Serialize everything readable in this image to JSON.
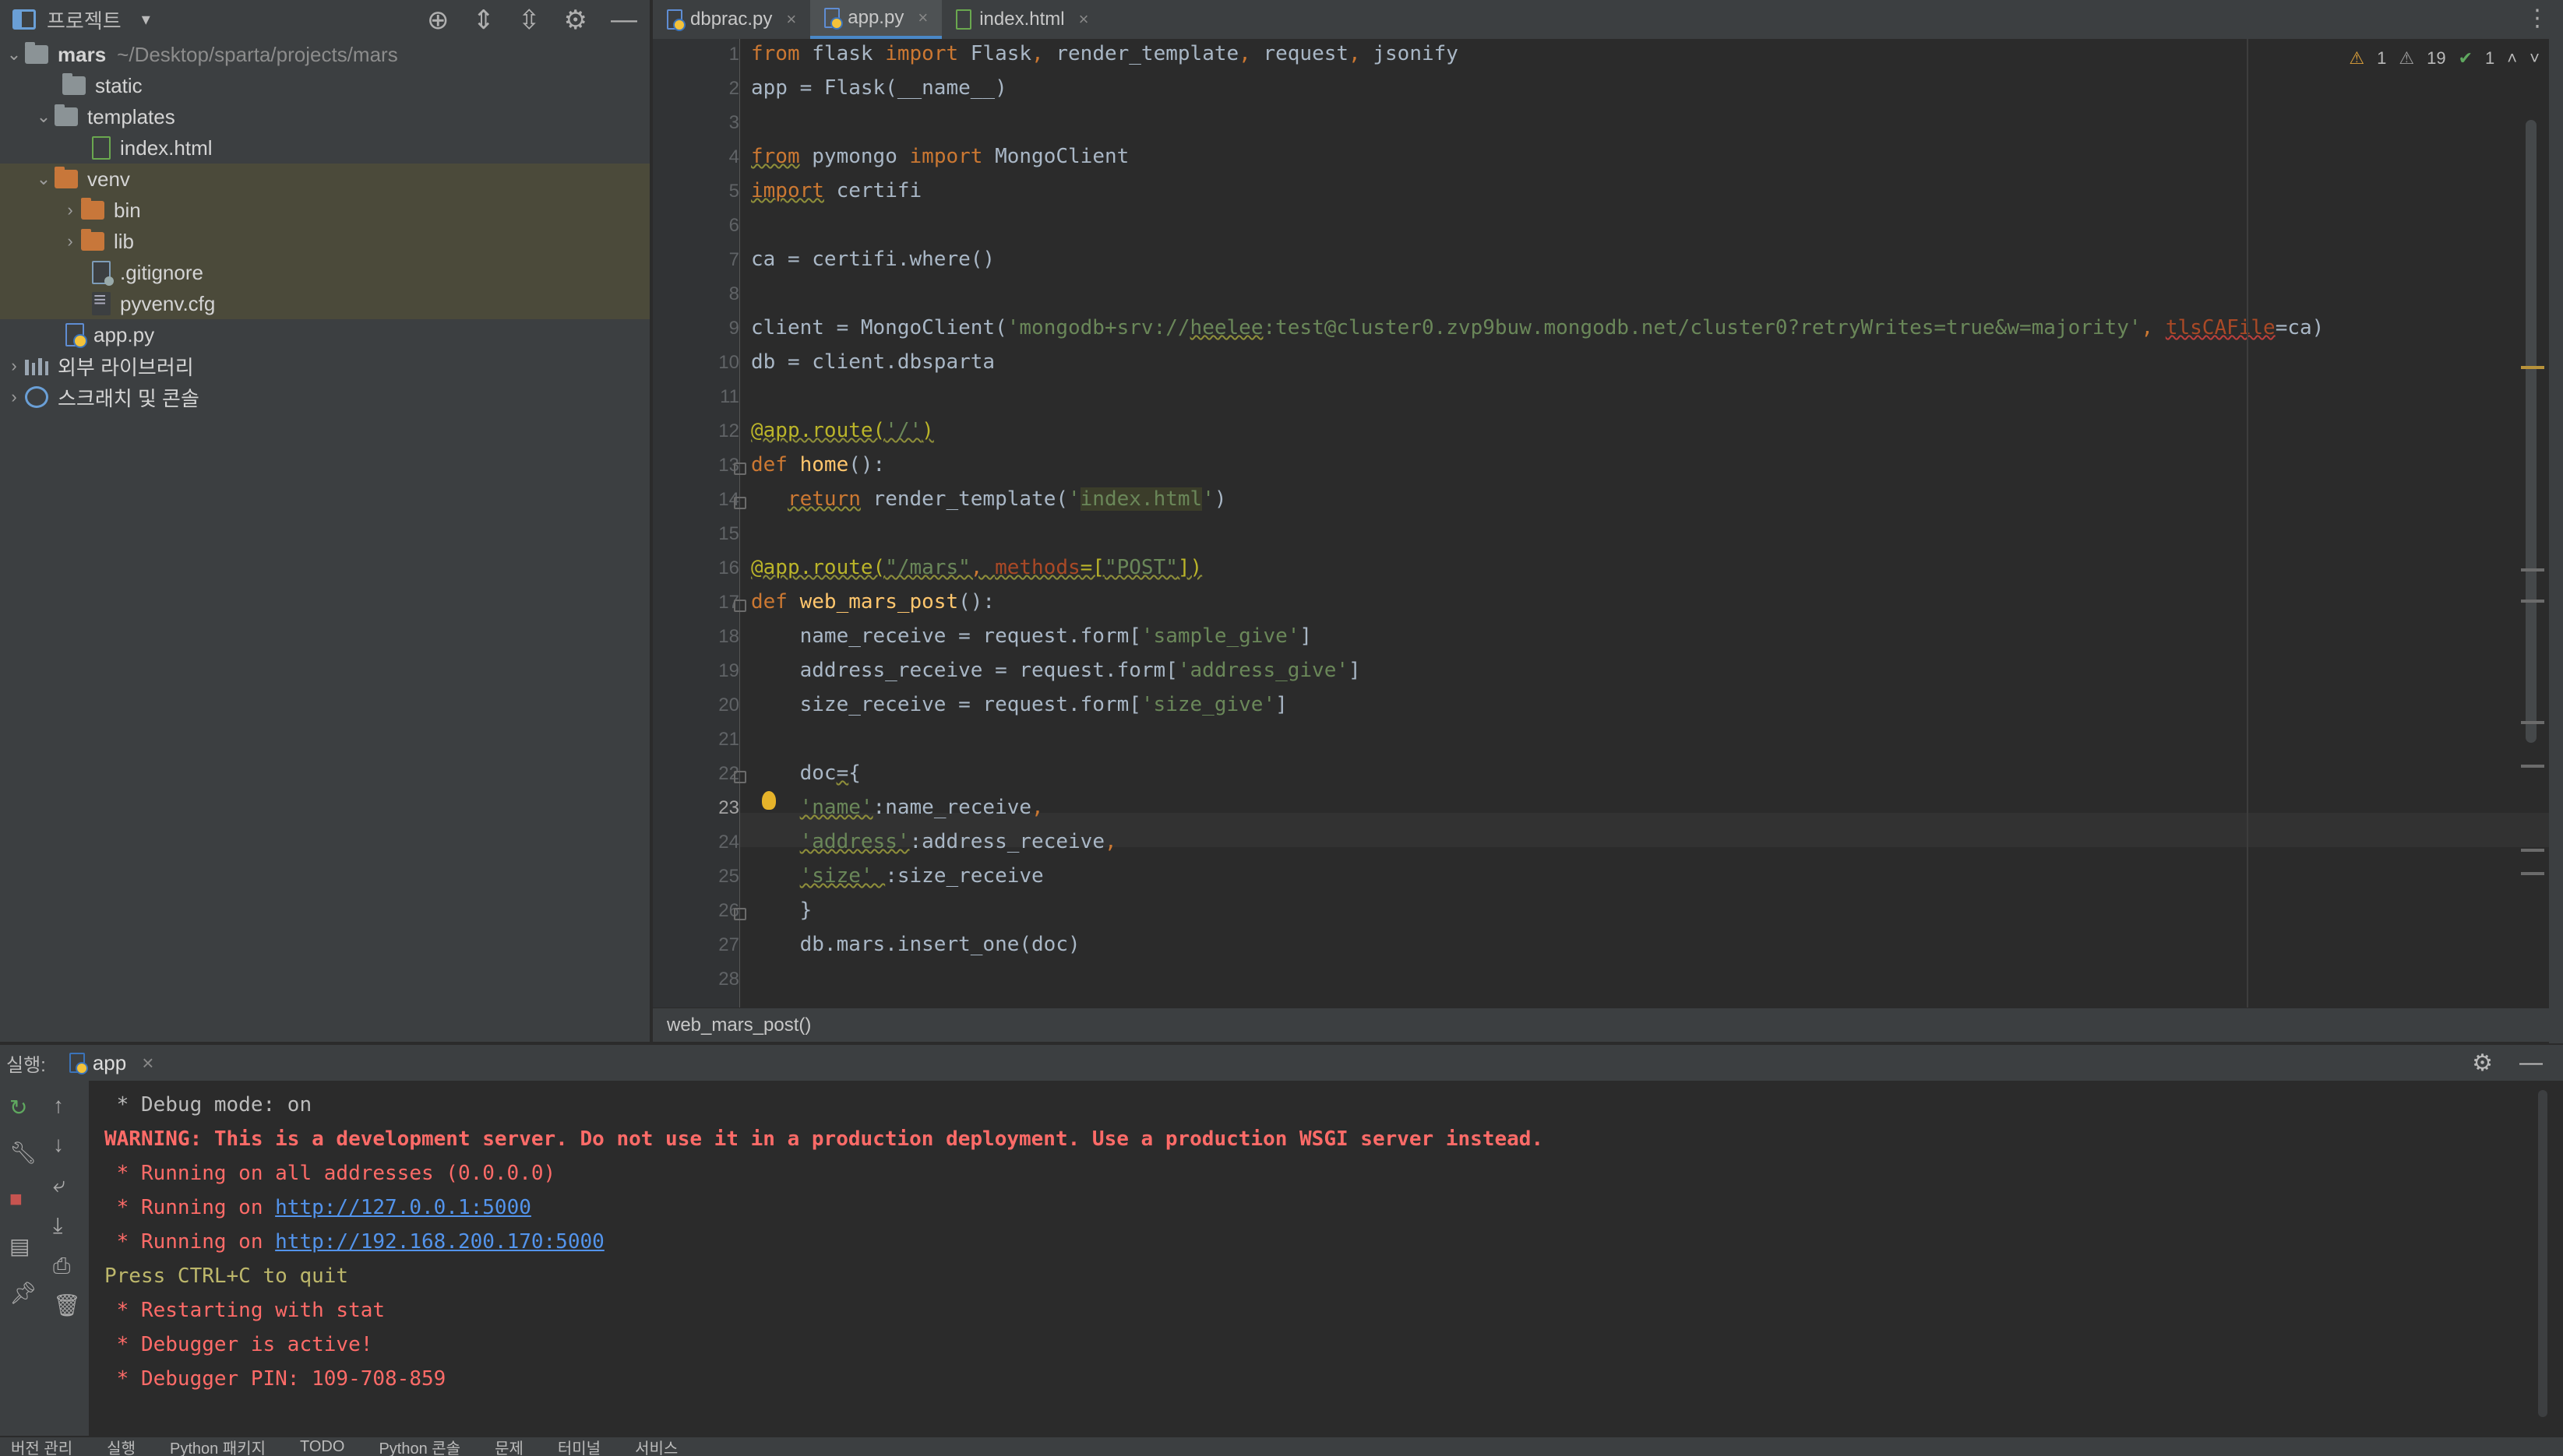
{
  "project": {
    "title": "프로젝트",
    "dropdown": "▾",
    "tree": [
      {
        "label": "mars",
        "path": "~/Desktop/sparta/projects/mars"
      },
      {
        "label": "static"
      },
      {
        "label": "templates"
      },
      {
        "label": "index.html"
      },
      {
        "label": "venv"
      },
      {
        "label": "bin"
      },
      {
        "label": "lib"
      },
      {
        "label": ".gitignore"
      },
      {
        "label": "pyvenv.cfg"
      },
      {
        "label": "app.py"
      },
      {
        "label": "외부 라이브러리"
      },
      {
        "label": "스크래치 및 콘솔"
      }
    ]
  },
  "tabs": [
    {
      "label": "dbprac.py",
      "close": "×"
    },
    {
      "label": "app.py",
      "close": "×"
    },
    {
      "label": "index.html",
      "close": "×"
    }
  ],
  "inspections": {
    "warnings": "1",
    "weak": "19",
    "ok": "1"
  },
  "editor": {
    "line_numbers": [
      "1",
      "2",
      "3",
      "4",
      "5",
      "6",
      "7",
      "8",
      "9",
      "10",
      "11",
      "12",
      "13",
      "14",
      "15",
      "16",
      "17",
      "18",
      "19",
      "20",
      "21",
      "22",
      "23",
      "24",
      "25",
      "26",
      "27",
      "28"
    ],
    "current_line": "23"
  },
  "breadcrumb": "web_mars_post()",
  "run": {
    "label": "실행:",
    "tab": "app",
    "console": [
      " * Debug mode: on",
      "WARNING: This is a development server. Do not use it in a production deployment. Use a production WSGI server instead.",
      " * Running on all addresses (0.0.0.0)",
      " * Running on ",
      "http://127.0.0.1:5000",
      " * Running on ",
      "http://192.168.200.170:5000",
      "Press CTRL+C to quit",
      " * Restarting with stat",
      " * Debugger is active!",
      " * Debugger PIN: 109-708-859"
    ]
  },
  "bottom_bar": [
    "버전 관리",
    "실행",
    "Python 패키지",
    "TODO",
    "Python 콘솔",
    "문제",
    "터미널",
    "서비스"
  ]
}
